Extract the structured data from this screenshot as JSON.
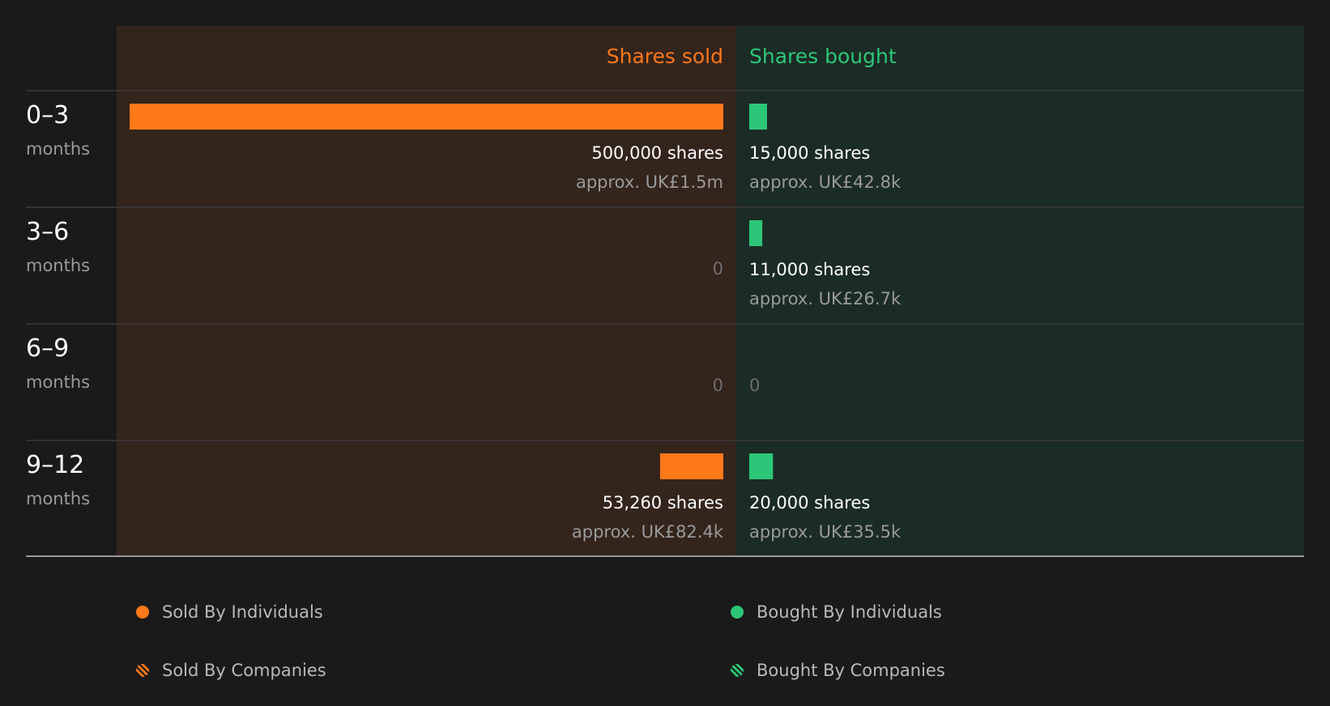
{
  "chart_data": {
    "type": "bar",
    "orientation": "diverging-horizontal",
    "headers": {
      "sold": "Shares sold",
      "bought": "Shares bought"
    },
    "categories": [
      {
        "range": "0–3",
        "unit": "months"
      },
      {
        "range": "3–6",
        "unit": "months"
      },
      {
        "range": "6–9",
        "unit": "months"
      },
      {
        "range": "9–12",
        "unit": "months"
      }
    ],
    "series": [
      {
        "name": "Shares sold",
        "values": [
          500000,
          0,
          0,
          53260
        ],
        "labels": [
          "500,000 shares",
          "0",
          "0",
          "53,260 shares"
        ],
        "approx": [
          "approx. UK£1.5m",
          "",
          "",
          "approx. UK£82.4k"
        ]
      },
      {
        "name": "Shares bought",
        "values": [
          15000,
          11000,
          0,
          20000
        ],
        "labels": [
          "15,000 shares",
          "11,000 shares",
          "0",
          "20,000 shares"
        ],
        "approx": [
          "approx. UK£42.8k",
          "approx. UK£26.7k",
          "",
          "approx. UK£35.5k"
        ]
      }
    ],
    "xlim": [
      0,
      500000
    ],
    "legend": [
      "Sold By Individuals",
      "Bought By Individuals",
      "Sold By Companies",
      "Bought By Companies"
    ],
    "legend_position": "bottom",
    "colors": {
      "sold": "#ff7819",
      "bought": "#2cc678",
      "sold_bg": "#33241c",
      "bought_bg": "#1b2b25",
      "background": "#1a1a1a"
    }
  }
}
